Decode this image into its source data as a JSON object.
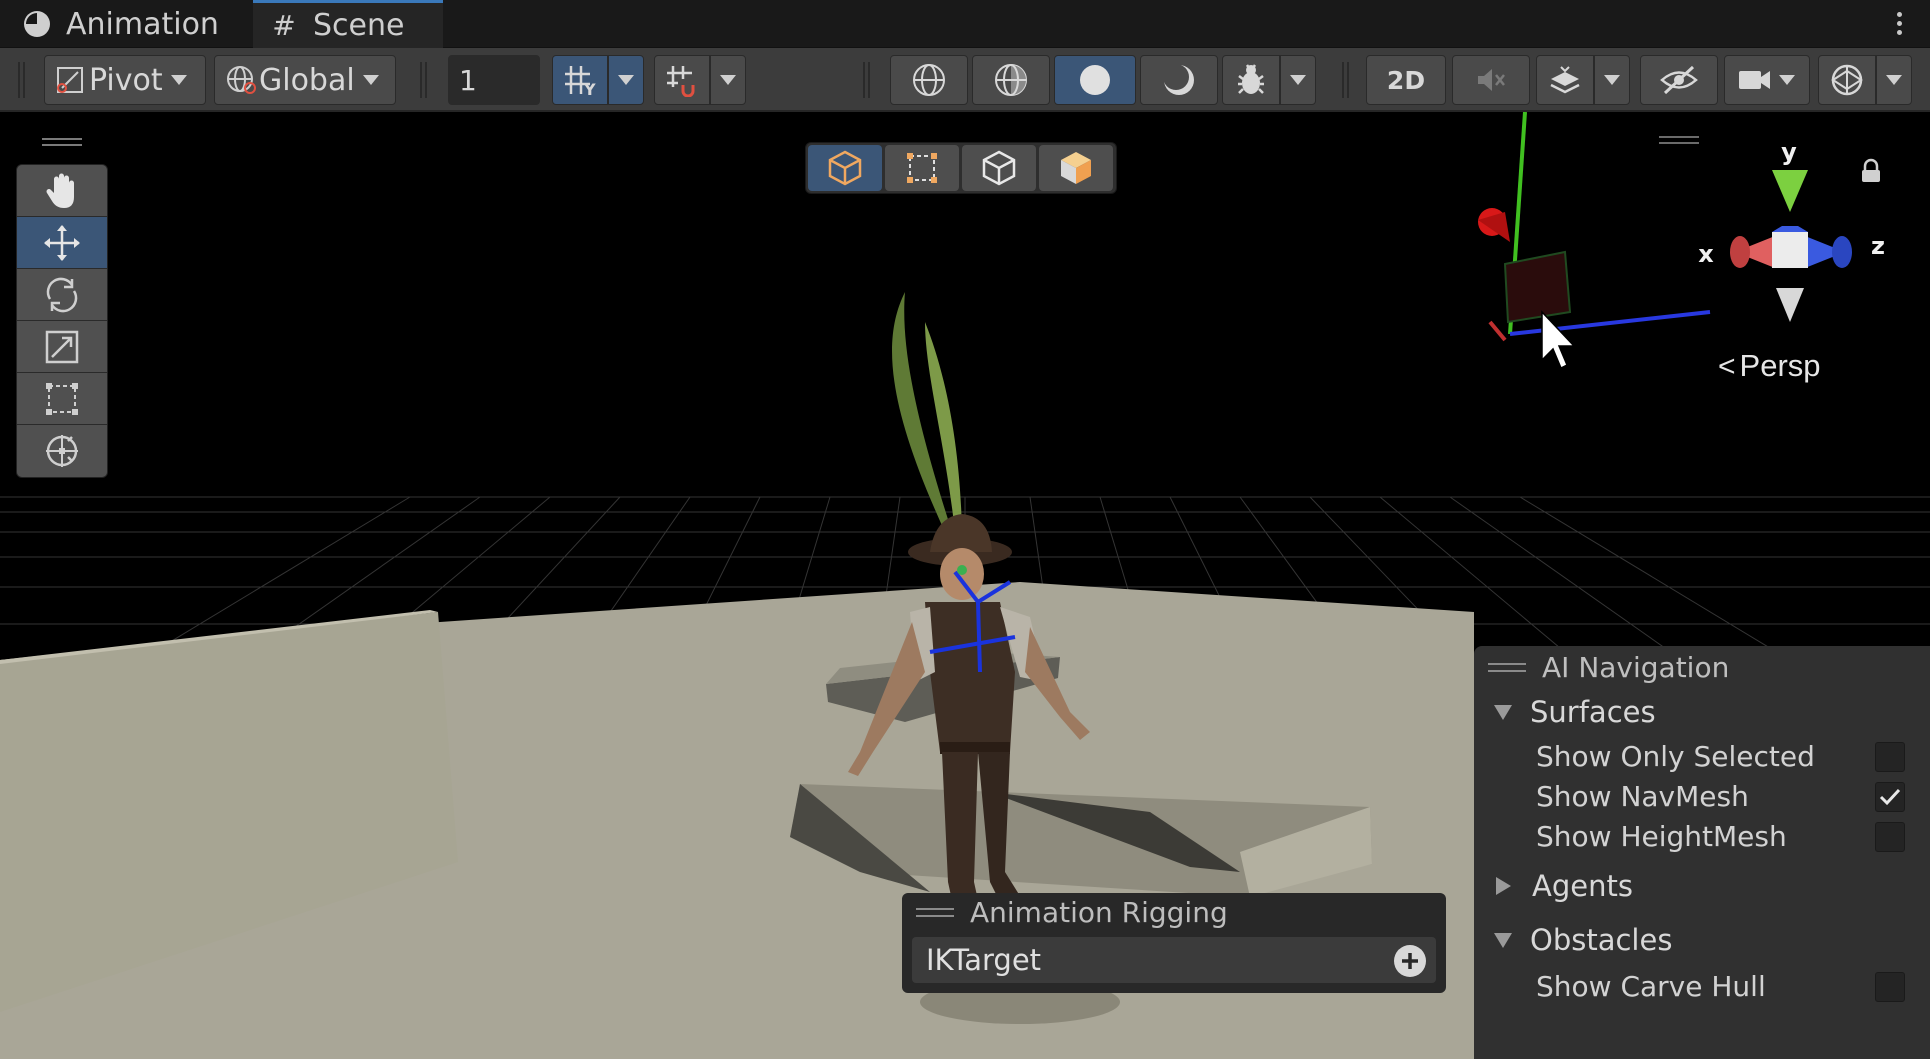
{
  "tabs": [
    {
      "label": "Animation",
      "icon": "clock-icon"
    },
    {
      "label": "Scene",
      "icon": "hash-icon",
      "active": true
    }
  ],
  "toolbar": {
    "pivot_label": "Pivot",
    "global_label": "Global",
    "grid_size_value": "1",
    "mode_2d_label": "2D"
  },
  "tools": [
    "hand-tool",
    "move-tool",
    "rotate-tool",
    "scale-tool",
    "rect-tool",
    "transform-tool"
  ],
  "active_tool": "move-tool",
  "overlay_modes": [
    "cube-mode",
    "rect-mode",
    "wire-cube-mode",
    "shaded-cube-mode"
  ],
  "gizmo": {
    "x_label": "x",
    "y_label": "y",
    "z_label": "z",
    "projection_label": "Persp"
  },
  "ai_navigation": {
    "title": "AI Navigation",
    "surfaces": {
      "label": "Surfaces",
      "show_only_selected": {
        "label": "Show Only Selected",
        "checked": false
      },
      "show_navmesh": {
        "label": "Show NavMesh",
        "checked": true
      },
      "show_heightmesh": {
        "label": "Show HeightMesh",
        "checked": false
      }
    },
    "agents_label": "Agents",
    "obstacles": {
      "label": "Obstacles",
      "show_carve_hull": {
        "label": "Show Carve Hull",
        "checked": false
      }
    }
  },
  "animation_rigging": {
    "title": "Animation Rigging",
    "target_field": "IKTarget"
  },
  "colors": {
    "accent": "#3b5677",
    "tab_highlight": "#3a79bb",
    "ground": "#a8a595",
    "axis_x": "#d04040",
    "axis_y": "#6cc040",
    "axis_z": "#3050e0"
  }
}
